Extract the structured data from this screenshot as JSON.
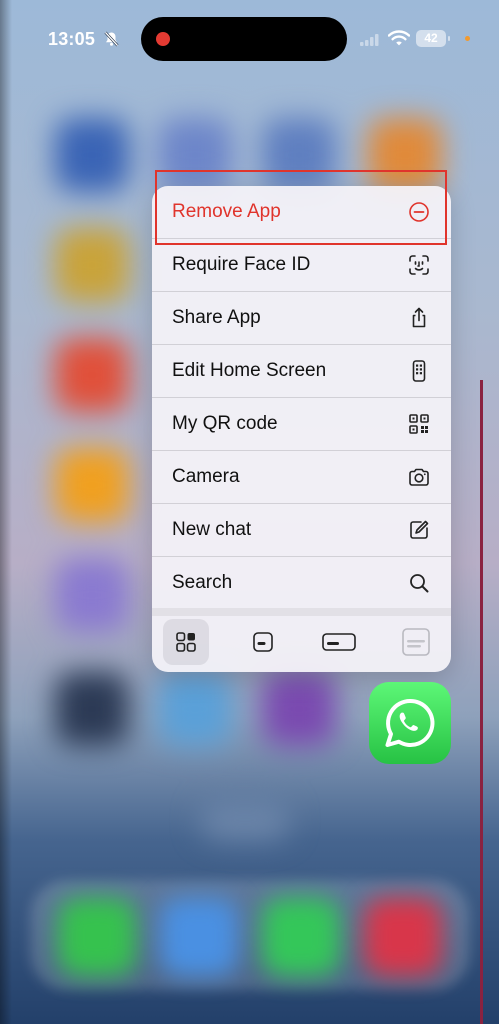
{
  "status_bar": {
    "time": "13:05",
    "battery_level": "42",
    "icons": [
      "bell-slash-icon",
      "cellular-signal-icon",
      "wifi-icon",
      "battery-icon"
    ]
  },
  "context_menu": {
    "items": [
      {
        "label": "Remove App",
        "icon": "minus-circle-icon",
        "destructive": true
      },
      {
        "label": "Require Face ID",
        "icon": "face-id-icon"
      },
      {
        "label": "Share App",
        "icon": "share-icon"
      },
      {
        "label": "Edit Home Screen",
        "icon": "phone-icon"
      },
      {
        "label": "My QR code",
        "icon": "qr-code-icon"
      },
      {
        "label": "Camera",
        "icon": "camera-icon"
      },
      {
        "label": "New chat",
        "icon": "compose-icon"
      },
      {
        "label": "Search",
        "icon": "search-icon"
      }
    ],
    "widget_sizes": [
      {
        "icon": "app-grid-icon",
        "selected": true
      },
      {
        "icon": "small-widget-icon",
        "selected": false
      },
      {
        "icon": "medium-widget-icon",
        "selected": false
      },
      {
        "icon": "large-widget-icon",
        "selected": false,
        "disabled": true
      }
    ]
  },
  "app": {
    "icon": "whatsapp-icon"
  },
  "colors": {
    "destructive": "#e0342c",
    "whatsapp_green": "#27c244",
    "highlight": "#e0342c"
  }
}
